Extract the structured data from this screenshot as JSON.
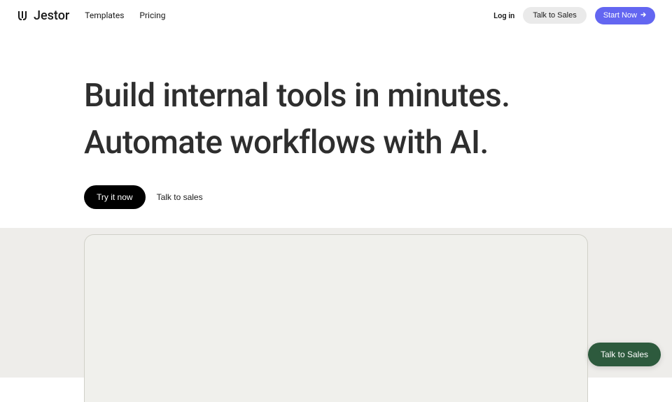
{
  "header": {
    "logo": "Jestor",
    "nav": {
      "templates": "Templates",
      "pricing": "Pricing"
    },
    "login": "Log in",
    "talk_to_sales": "Talk to Sales",
    "start_now": "Start Now"
  },
  "hero": {
    "title_line1": "Build internal tools in minutes.",
    "title_line2": "Automate workflows with AI.",
    "try_button": "Try it now",
    "talk_button": "Talk to sales"
  },
  "floating": {
    "chat_label": "Talk to Sales"
  }
}
